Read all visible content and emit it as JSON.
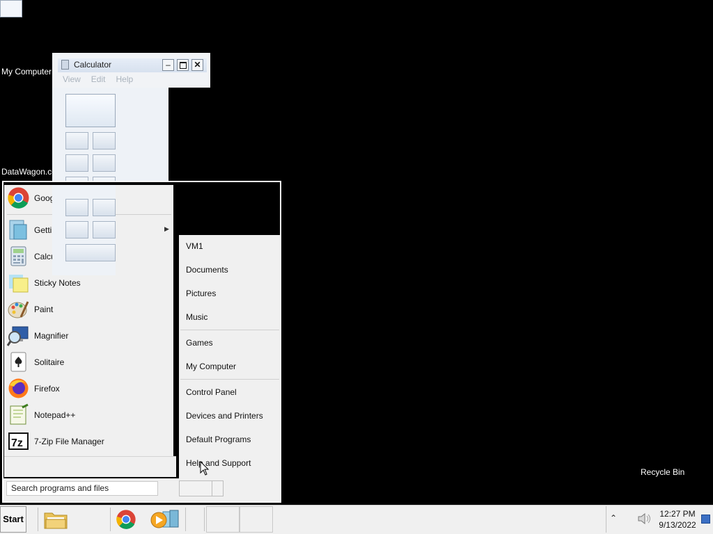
{
  "desktop": {
    "icons": [
      {
        "label": "My Computer"
      },
      {
        "label": "DataWagon.co"
      },
      {
        "label": "Recycle Bin"
      }
    ]
  },
  "calculator": {
    "title": "Calculator",
    "menu": [
      "View",
      "Edit",
      "Help"
    ],
    "minimize": "–",
    "close": "✕"
  },
  "start_menu": {
    "pinned": [
      {
        "label": "Goog",
        "icon": "chrome-icon"
      }
    ],
    "recent": [
      {
        "label": "Getti",
        "icon": "getting-started-icon",
        "has_submenu": true
      },
      {
        "label": "Calcu",
        "icon": "calculator-icon"
      },
      {
        "label": "Sticky Notes",
        "icon": "sticky-notes-icon"
      },
      {
        "label": "Paint",
        "icon": "paint-icon"
      },
      {
        "label": "Magnifier",
        "icon": "magnifier-icon"
      },
      {
        "label": "Solitaire",
        "icon": "solitaire-icon"
      },
      {
        "label": "Firefox",
        "icon": "firefox-icon"
      },
      {
        "label": "Notepad++",
        "icon": "notepadpp-icon"
      },
      {
        "label": "7-Zip File Manager",
        "icon": "7zip-icon"
      }
    ],
    "right_items": [
      {
        "label": "VM1"
      },
      {
        "label": "Documents"
      },
      {
        "label": "Pictures"
      },
      {
        "label": "Music"
      },
      {
        "label": "Games"
      },
      {
        "label": "My Computer"
      },
      {
        "label": "Control Panel"
      },
      {
        "label": "Devices and Printers"
      },
      {
        "label": "Default Programs"
      },
      {
        "label": "Help and Support"
      }
    ],
    "search_placeholder": "Search programs and files"
  },
  "taskbar": {
    "start_label": "Start",
    "clock_time": "12:27 PM",
    "clock_date": "9/13/2022"
  }
}
